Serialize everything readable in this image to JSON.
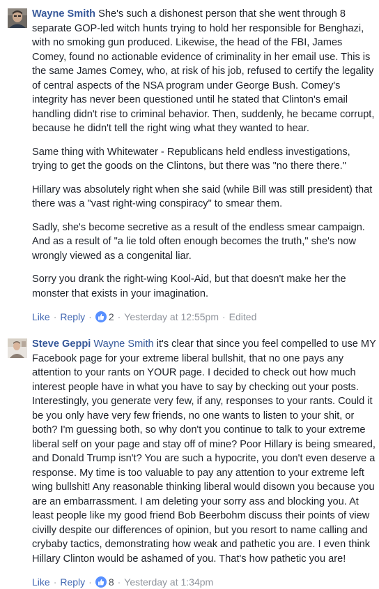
{
  "comments": [
    {
      "author": "Wayne Smith",
      "paragraphs": [
        "She's such a dishonest person that she went through 8 separate GOP-led witch hunts trying to hold her responsible for Benghazi, with no smoking gun produced. Likewise, the head of the FBI, James Comey, found no actionable evidence of criminality in her email use. This is the same James Comey, who, at risk of his job, refused to certify the legality of central aspects of the NSA program under George Bush. Comey's integrity has never been questioned until he stated that Clinton's email handling didn't rise to criminal behavior. Then, suddenly, he became corrupt, because he didn't tell the right wing what they wanted to hear.",
        "Same thing with Whitewater - Republicans held endless investigations, trying to get the goods on the Clintons, but there was \"no there there.\"",
        "Hillary was absolutely right when she said (while Bill was still president) that there was a \"vast right-wing conspiracy\" to smear them.",
        "Sadly, she's become secretive as a result of the endless smear campaign. And as a result of \"a lie told often enough becomes the truth,\" she's now wrongly viewed as a congenital liar.",
        "Sorry you drank the right-wing Kool-Aid, but that doesn't make her the monster that exists in your imagination."
      ],
      "actions": {
        "like": "Like",
        "reply": "Reply",
        "reaction_count": "2",
        "time": "Yesterday at 12:55pm",
        "edited": "Edited"
      }
    },
    {
      "author": "Steve Geppi",
      "mention": "Wayne Smith",
      "text": "it's clear that since you feel compelled to use MY Facebook page for your extreme liberal bullshit, that no one pays any attention to your rants on YOUR page. I decided to check out how much interest people have in what you have to say by checking out your posts. Interestingly, you generate very few, if any, responses to your rants. Could it be you only have very few friends, no one wants to listen to your shit, or both? I'm guessing both, so why don't you continue to talk to your extreme liberal self on your page and stay off of mine? Poor Hillary is being smeared, and Donald Trump isn't? You are such a hypocrite, you don't even deserve a response. My time is too valuable to pay any attention to your extreme left wing bullshit! Any reasonable thinking liberal would disown you because you are an embarrassment. I am deleting your sorry ass and blocking you. At least people like my good friend Bob Beerbohm discuss their points of view civilly despite our differences of opinion, but you resort to name calling and crybaby tactics, demonstrating how weak and pathetic you are. I even think Hillary Clinton would be ashamed of you. That's how pathetic you are!",
      "actions": {
        "like": "Like",
        "reply": "Reply",
        "reaction_count": "8",
        "time": "Yesterday at 1:34pm"
      }
    }
  ],
  "colors": {
    "name_blue": "#365899",
    "link_blue": "#4267b2",
    "meta_grey": "#90949c",
    "like_badge": "#5890ff"
  },
  "icons": {
    "reaction": "thumbs-up-icon"
  }
}
